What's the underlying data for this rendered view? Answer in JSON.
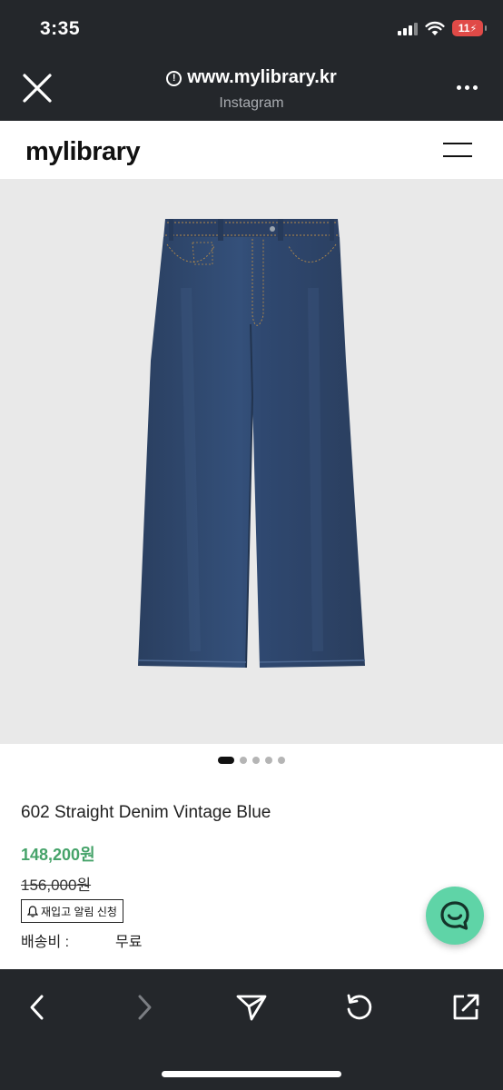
{
  "status_bar": {
    "time": "3:35",
    "battery": "11",
    "icons": [
      "signal-icon",
      "wifi-icon",
      "battery-charging-icon"
    ]
  },
  "browser": {
    "url": "www.mylibrary.kr",
    "source_label": "Instagram",
    "close_icon": "close-icon",
    "more_icon": "more-icon",
    "toolbar_icons": [
      "back-icon",
      "forward-icon",
      "share-send-icon",
      "reload-icon",
      "open-external-icon"
    ]
  },
  "site": {
    "logo": "mylibrary",
    "menu_icon": "hamburger-menu-icon"
  },
  "carousel": {
    "total_slides": 5,
    "active_index": 0
  },
  "product": {
    "name": "602 Straight Denim Vintage Blue",
    "sale_price": "148,200원",
    "original_price": "156,000원",
    "restock_label": "재입고 알림 신청",
    "shipping_label": "배송비 :",
    "shipping_value": "무료"
  },
  "colors": {
    "browser_chrome": "#24272b",
    "sale_price": "#46a36a",
    "chat_button": "#5fd4a7",
    "denim": "#2e4466"
  }
}
